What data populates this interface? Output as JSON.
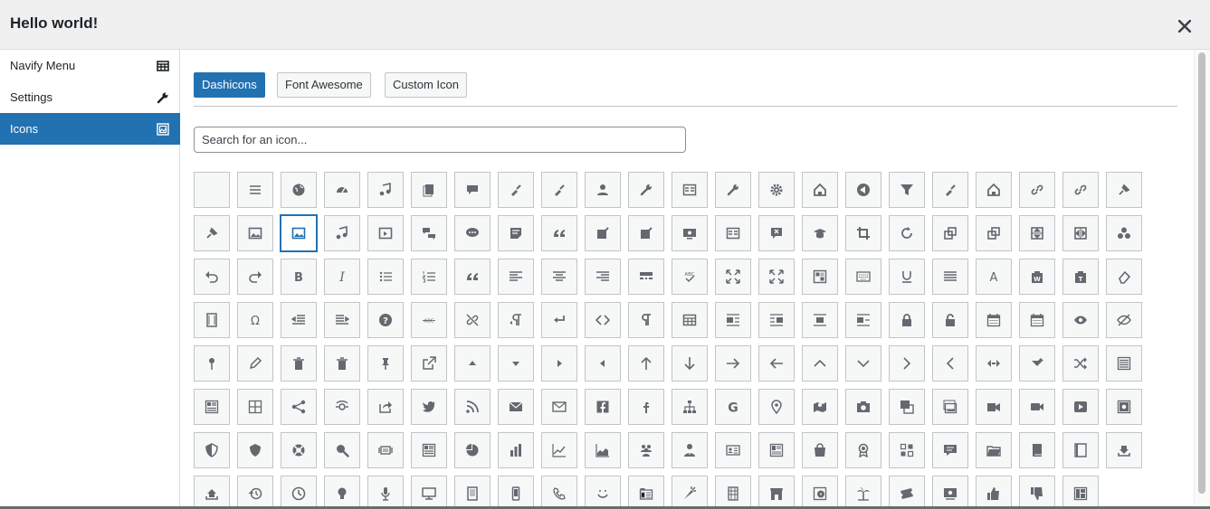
{
  "modal": {
    "title": "Hello world!",
    "close_icon": "close-icon"
  },
  "sidebar": {
    "items": [
      {
        "label": "Navify Menu",
        "icon": "menu-table-icon",
        "active": false
      },
      {
        "label": "Settings",
        "icon": "wrench-icon",
        "active": false
      },
      {
        "label": "Icons",
        "icon": "image-icon",
        "active": true
      }
    ]
  },
  "tabs": [
    {
      "label": "Dashicons",
      "active": true
    },
    {
      "label": "Font Awesome",
      "active": false
    },
    {
      "label": "Custom Icon",
      "active": false
    }
  ],
  "search": {
    "placeholder": "Search for an icon..."
  },
  "colors": {
    "accent": "#2271b1",
    "header_bg": "#f0f0f1",
    "cell_bg": "#f6f7f7",
    "cell_border": "#c3c4c7",
    "icon": "#646970"
  },
  "icons": [
    "blank",
    "menu",
    "admin-site",
    "dashboard",
    "admin-media",
    "admin-page",
    "admin-comments",
    "admin-appearance",
    "admin-plugins",
    "admin-users",
    "admin-tools",
    "admin-settings",
    "admin-network",
    "admin-generic",
    "admin-home",
    "admin-collapse",
    "filter",
    "admin-customizer",
    "admin-multisite",
    "admin-links",
    "format-links",
    "admin-post",
    "admin-post-alt",
    "format-image",
    "format-gallery",
    "format-audio",
    "format-video",
    "format-chat",
    "format-status",
    "format-aside",
    "format-quote",
    "welcome-write-blog",
    "welcome-add-page",
    "welcome-view-site",
    "welcome-widgets-menus",
    "welcome-comments",
    "welcome-learn-more",
    "image-crop",
    "image-rotate",
    "image-rotate-left",
    "image-rotate-right",
    "image-flip-vertical",
    "image-flip-horizontal",
    "image-filter",
    "undo",
    "redo",
    "editor-bold",
    "editor-italic",
    "editor-ul",
    "editor-ol",
    "editor-quote",
    "editor-alignleft",
    "editor-aligncenter",
    "editor-alignright",
    "editor-insertmore",
    "editor-spellcheck",
    "editor-expand",
    "editor-contract",
    "editor-kitchensink",
    "editor-keyboard",
    "editor-underline",
    "editor-justify",
    "editor-textcolor",
    "editor-paste-word",
    "editor-paste-text",
    "editor-removeformatting",
    "editor-video",
    "editor-customchar",
    "editor-outdent",
    "editor-indent",
    "editor-help",
    "editor-strikethrough",
    "editor-unlink",
    "editor-rtl",
    "editor-break",
    "editor-code",
    "editor-paragraph",
    "editor-table",
    "align-left",
    "align-right",
    "align-center",
    "align-none",
    "lock",
    "unlock",
    "calendar",
    "calendar-alt",
    "visibility",
    "hidden",
    "post-status",
    "edit",
    "trash",
    "trash-alt",
    "sticky",
    "external",
    "arrow-up",
    "arrow-down",
    "arrow-right",
    "arrow-left",
    "arrow-up-alt",
    "arrow-down-alt",
    "arrow-right-alt",
    "arrow-left-alt",
    "arrow-up-alt2",
    "arrow-down-alt2",
    "arrow-right-alt2",
    "arrow-left-alt2",
    "sort",
    "leftright",
    "randomize",
    "list-view",
    "exerpt-view",
    "grid-view",
    "share",
    "share-alt",
    "share-alt2",
    "twitter",
    "rss",
    "email",
    "email-alt",
    "facebook",
    "facebook-alt",
    "networking",
    "googleplus",
    "location",
    "location-alt",
    "camera",
    "images-alt",
    "images-alt2",
    "video-alt",
    "video-alt2",
    "video-alt3",
    "vault",
    "shield",
    "shield-alt",
    "sos",
    "search",
    "slides",
    "analytics",
    "chart-pie",
    "chart-bar",
    "chart-line",
    "chart-area",
    "groups",
    "businessman",
    "id",
    "id-alt",
    "products",
    "awards",
    "forms",
    "testimonial",
    "portfolio",
    "book",
    "book-alt",
    "download",
    "upload",
    "backup",
    "clock",
    "lightbulb",
    "microphone",
    "desktop",
    "tablet",
    "smartphone",
    "phone",
    "smiley",
    "index-card",
    "carrot",
    "building",
    "store",
    "album",
    "palmtree",
    "tickets-alt",
    "money",
    "thumbs-up",
    "thumbs-down",
    "layout"
  ],
  "selected_icon": "format-gallery"
}
